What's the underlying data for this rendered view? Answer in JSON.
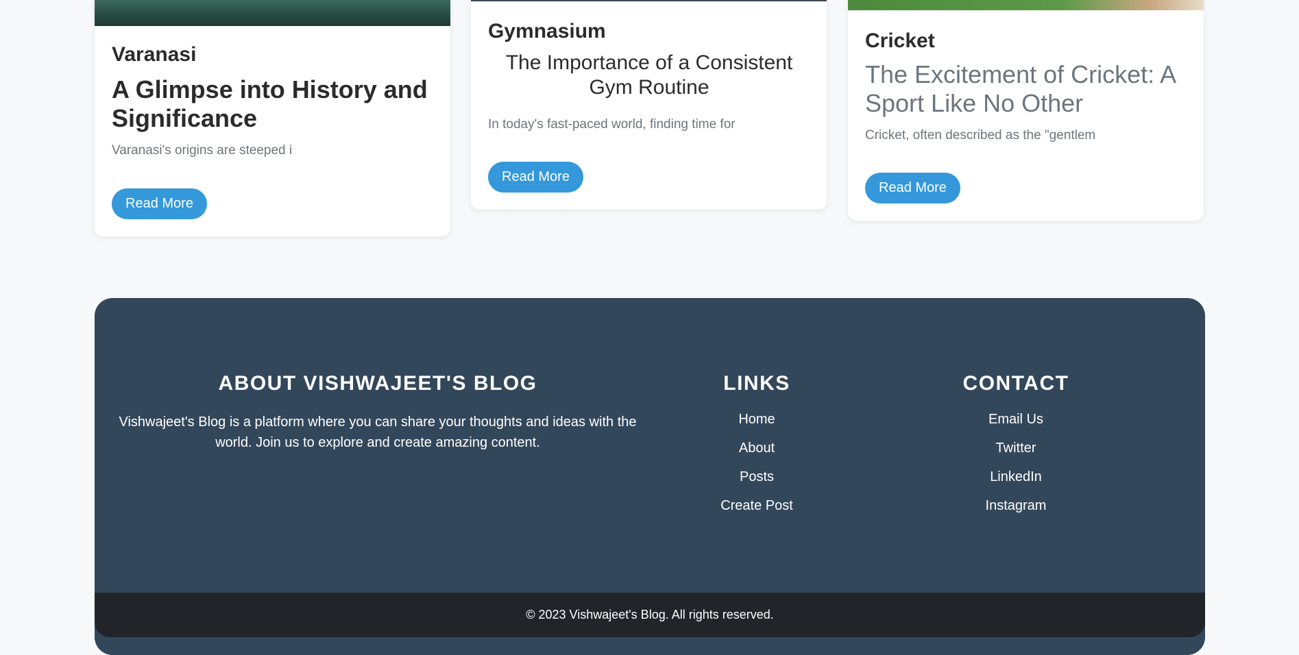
{
  "cards": [
    {
      "category": "Varanasi",
      "title": "A Glimpse into History and Significance",
      "excerpt": "Varanasi's origins are steeped i",
      "button": "Read More"
    },
    {
      "category": "Gymnasium",
      "title": "The Importance of a Consistent Gym Routine",
      "excerpt": "In today's fast-paced world, finding time for",
      "button": "Read More"
    },
    {
      "category": "Cricket",
      "title": "The Excitement of Cricket: A Sport Like No Other",
      "excerpt": "Cricket, often described as the \"gentlem",
      "button": "Read More"
    }
  ],
  "footer": {
    "about": {
      "heading": "ABOUT VISHWAJEET'S BLOG",
      "text": "Vishwajeet's Blog is a platform where you can share your thoughts and ideas with the world. Join us to explore and create amazing content."
    },
    "links": {
      "heading": "LINKS",
      "items": [
        "Home",
        "About",
        "Posts",
        "Create Post"
      ]
    },
    "contact": {
      "heading": "CONTACT",
      "items": [
        "Email Us",
        "Twitter",
        "LinkedIn",
        "Instagram"
      ]
    },
    "copyright": "© 2023 Vishwajeet's Blog. All rights reserved."
  },
  "colors": {
    "accent": "#3498db",
    "footer_bg": "#33475b",
    "footer_bottom_bg": "#212529",
    "page_bg": "#f6f8fa"
  }
}
